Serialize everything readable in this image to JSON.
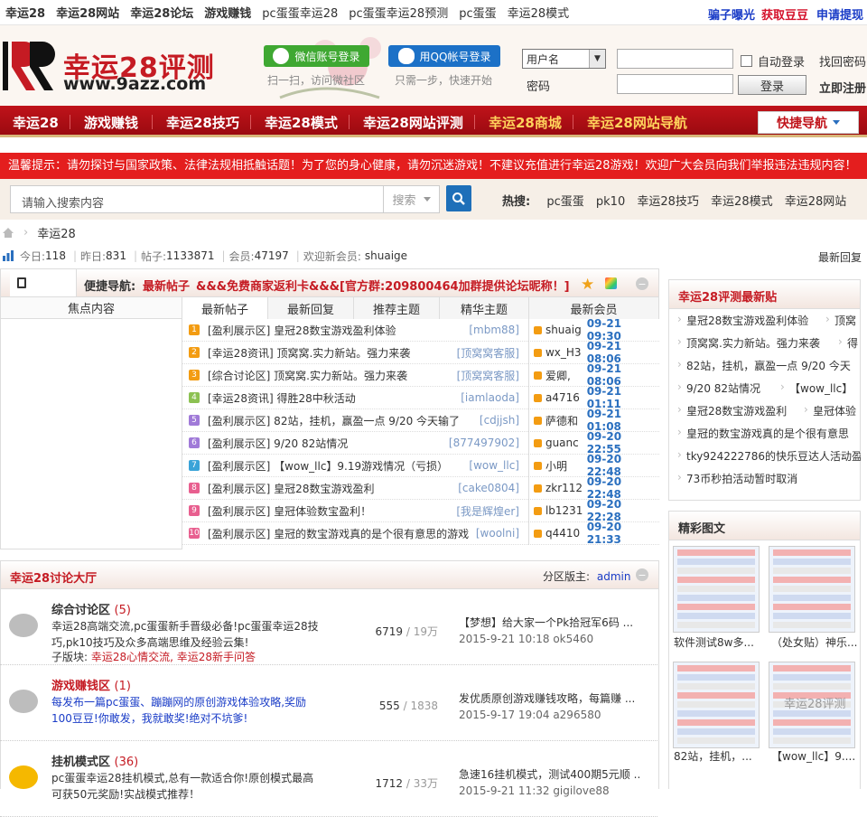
{
  "topbar": {
    "links": [
      "幸运28",
      "幸运28网站",
      "幸运28论坛",
      "游戏赚钱",
      "pc蛋蛋幸运28",
      "pc蛋蛋幸运28预测",
      "pc蛋蛋",
      "幸运28模式"
    ],
    "right_links": [
      "骗子曝光",
      "获取豆豆",
      "申请提现"
    ],
    "right_colors": [
      "#1a3cc7",
      "#d4102a",
      "#1a3cc7"
    ]
  },
  "header": {
    "logo_title": "幸运28评测",
    "logo_url": "www.9azz.com",
    "wechat_login": "微信账号登录",
    "wechat_sub": "扫一扫，访问微社区",
    "qq_login": "用QQ帐号登录",
    "qq_sub": "只需一步，快速开始",
    "user_select": "用户名",
    "password_label": "密码",
    "auto_login": "自动登录",
    "find_password": "找回密码",
    "login_button": "登录",
    "register": "立即注册"
  },
  "nav": {
    "items": [
      "幸运28",
      "游戏赚钱",
      "幸运28技巧",
      "幸运28模式",
      "幸运28网站评测",
      "幸运28商城",
      "幸运28网站导航"
    ],
    "quick_nav": "快捷导航"
  },
  "notice": "温馨提示：请勿探讨与国家政策、法律法规相抵触话题！为了您的身心健康，请勿沉迷游戏！不建议充值进行幸运28游戏！欢迎广大会员向我们举报违法违规内容！",
  "search": {
    "placeholder": "请输入搜索内容",
    "type": "搜索",
    "hot_label": "热搜:",
    "hot_words": [
      "pc蛋蛋",
      "pk10",
      "幸运28技巧",
      "幸运28模式",
      "幸运28网站"
    ]
  },
  "breadcrumb": "幸运28",
  "stats": {
    "today_label": "今日:",
    "today": "118",
    "yesterday_label": "昨日:",
    "yesterday": "831",
    "posts_label": "帖子:",
    "posts": "1133871",
    "members_label": "会员:",
    "members": "47197",
    "welcome_label": "欢迎新会员:",
    "new_member": "shuaige",
    "latest_reply": "最新回复"
  },
  "quicknav": {
    "label": "便捷导航:",
    "link1": "最新帖子",
    "link2": "&&&免费商家返利卡&&&[官方群:209800464加群提供论坛昵称！]"
  },
  "tabs": {
    "focus": "焦点内容",
    "list": [
      "最新帖子",
      "最新回复",
      "推荐主题",
      "精华主题"
    ],
    "members": "最新会员"
  },
  "threads": [
    {
      "n": "1",
      "c": "#f39c12",
      "title": "[盈利展示区] 皇冠28数宝游戏盈利体验",
      "author": "[mbm88]"
    },
    {
      "n": "2",
      "c": "#f39c12",
      "title": "[幸运28资讯] 顶窝窝.实力新站。强力来袭",
      "author": "[顶窝窝客服]"
    },
    {
      "n": "3",
      "c": "#f39c12",
      "title": "[综合讨论区] 顶窝窝.实力新站。强力来袭",
      "author": "[顶窝窝客服]"
    },
    {
      "n": "4",
      "c": "#8cc152",
      "title": "[幸运28资讯] 得胜28中秋活动",
      "author": "[iamlaoda]"
    },
    {
      "n": "5",
      "c": "#a07ad8",
      "title": "[盈利展示区] 82站，挂机，赢盈一点  9/20 今天输了",
      "author": "[cdjjsh]"
    },
    {
      "n": "6",
      "c": "#a07ad8",
      "title": "[盈利展示区] 9/20 82站情况",
      "author": "[877497902]"
    },
    {
      "n": "7",
      "c": "#3aa3d8",
      "title": "[盈利展示区] 【wow_llc】9.19游戏情况（亏损）",
      "author": "[wow_llc]"
    },
    {
      "n": "8",
      "c": "#e85f8f",
      "title": "[盈利展示区] 皇冠28数宝游戏盈利",
      "author": "[cake0804]"
    },
    {
      "n": "9",
      "c": "#e85f8f",
      "title": "[盈利展示区] 皇冠体验数宝盈利！",
      "author": "[我是辉煌er]"
    },
    {
      "n": "10",
      "c": "#e85f8f",
      "title": "[盈利展示区] 皇冠的数宝游戏真的是个很有意思的游戏",
      "author": "[woolni]"
    }
  ],
  "members": [
    {
      "name": "shuaig",
      "time": "09-21 09:30"
    },
    {
      "name": "wx_H3",
      "time": "09-21 08:06"
    },
    {
      "name": "爱卿,",
      "time": "09-21 08:06"
    },
    {
      "name": "a4716",
      "time": "09-21 01:11"
    },
    {
      "name": "萨德和",
      "time": "09-21 01:08"
    },
    {
      "name": "guanc",
      "time": "09-20 22:55"
    },
    {
      "name": "小明",
      "time": "09-20 22:48"
    },
    {
      "name": "zkr112",
      "time": "09-20 22:48"
    },
    {
      "name": "lb1231",
      "time": "09-20 22:28"
    },
    {
      "name": "q4410",
      "time": "09-20 21:33"
    }
  ],
  "hall": {
    "title": "幸运28讨论大厅",
    "moderator_label": "分区版主:",
    "moderator": "admin",
    "forums": [
      {
        "name": "综合讨论区",
        "count": "(5)",
        "name_color": "#333",
        "desc": "幸运28高端交流,pc蛋蛋新手晋级必备!pc蛋蛋幸运28技巧,pk10技巧及众多高端思维及经验云集!",
        "desc_color": "#333",
        "sub_label": "子版块:",
        "sub": "幸运28心情交流, 幸运28新手问答",
        "threads": "6719",
        "posts": "19万",
        "last": "【梦想】给大家一个Pk拾冠军6码 ...",
        "last_date": "2015-9-21 10:18 ok5460"
      },
      {
        "name": "游戏赚钱区",
        "count": "(1)",
        "name_color": "#c51b23",
        "desc": "每发布一篇pc蛋蛋、蹦蹦网的原创游戏体验攻略,奖励100豆豆!你敢发，我就敢奖!绝对不坑爹!",
        "desc_color": "#1a3cc7",
        "sub_label": "",
        "sub": "",
        "threads": "555",
        "posts": "1838",
        "last": "发优质原创游戏赚钱攻略，每篇赚 ...",
        "last_date": "2015-9-17 19:04 a296580"
      },
      {
        "name": "挂机模式区",
        "count": "(36)",
        "name_color": "#333",
        "desc": "pc蛋蛋幸运28挂机模式,总有一款适合你!原创模式最高可获50元奖励!实战模式推荐！",
        "desc_color": "#333",
        "sub_label": "",
        "sub": "",
        "threads": "1712",
        "posts": "33万",
        "last": "急速16挂机模式，测试400期5元顺 ...",
        "last_date": "2015-9-21 11:32 gigilove88"
      }
    ]
  },
  "right": {
    "latest_title": "幸运28评测最新贴",
    "latest": [
      "皇冠28数宝游戏盈利体验",
      "顶窝",
      "顶窝窝.实力新站。强力来袭",
      "得",
      "82站，挂机，赢盈一点  9/20 今天",
      "9/20 82站情况",
      "【wow_llc】",
      "皇冠28数宝游戏盈利",
      "皇冠体验",
      "皇冠的数宝游戏真的是个很有意思",
      "tky924222786的快乐豆达人活动盈",
      "73币秒拍活动暂时取消"
    ],
    "pics_title": "精彩图文",
    "pic_captions": [
      "软件测试8w多...",
      "（处女贴）神乐...",
      "82站，挂机，...",
      "【wow_llc】9...."
    ],
    "watermark": "幸运28评测"
  }
}
